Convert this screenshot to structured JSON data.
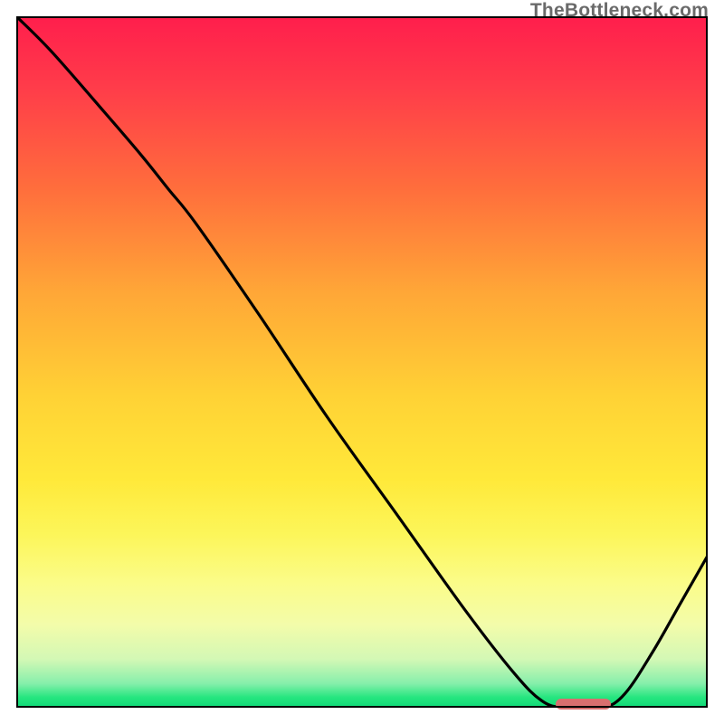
{
  "watermark": "TheBottleneck.com",
  "chart_data": {
    "type": "line",
    "title": "",
    "xlabel": "",
    "ylabel": "",
    "x_range": [
      0,
      100
    ],
    "y_range": [
      0,
      100
    ],
    "background": "vertical gradient red→green representing bottleneck severity",
    "series": [
      {
        "name": "bottleneck-curve",
        "x": [
          0,
          5,
          12,
          18,
          22,
          26,
          35,
          45,
          55,
          65,
          72,
          76,
          79,
          82,
          85,
          88,
          92,
          96,
          100
        ],
        "y": [
          100,
          95,
          87,
          80,
          75,
          70,
          57,
          42,
          28,
          14,
          5,
          1,
          0,
          0,
          0,
          2,
          8,
          15,
          22
        ]
      }
    ],
    "optimal_marker": {
      "x_start": 78,
      "x_end": 86,
      "y": 0,
      "color": "#d96f6f"
    }
  },
  "colors": {
    "curve": "#000000",
    "frame": "#000000",
    "watermark": "#6a6a6a",
    "marker": "#d96f6f"
  }
}
